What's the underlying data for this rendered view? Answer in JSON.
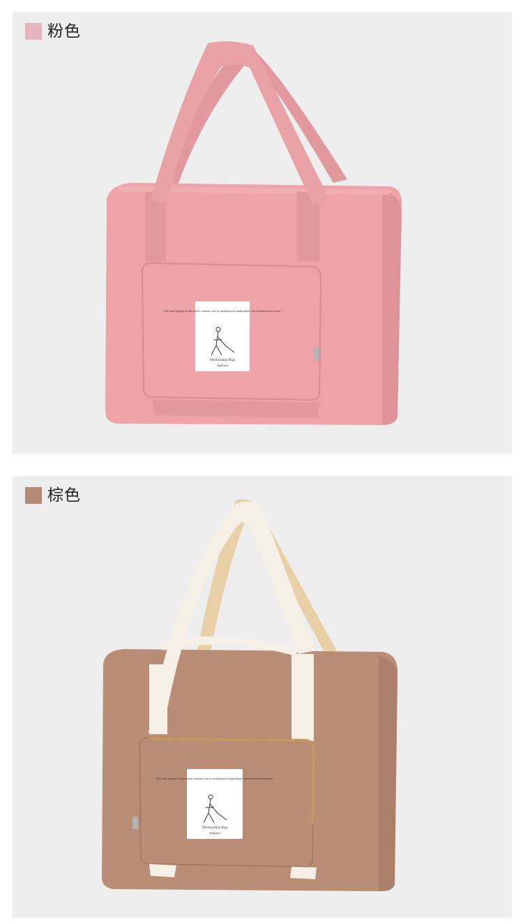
{
  "variants": [
    {
      "label": "粉色",
      "swatch_color": "#e6b5bd",
      "bag_color": "#eda3a8",
      "bag_shade": "#d98b92",
      "strap_color": "#e9a2a6",
      "strap_inner": "#e2999e",
      "tag": {
        "quote": "\"The real voyage of discovery consists, not in seeking new landscapes, but in having new eyes.\"",
        "brand": "Meituozijia Bag",
        "sub": "Fashion"
      }
    },
    {
      "label": "棕色",
      "swatch_color": "#b38a78",
      "bag_color": "#b98d76",
      "bag_shade": "#a77c66",
      "strap_color": "#f5efe6",
      "strap_inner": "#e8cfa6",
      "tag": {
        "quote": "\"The real voyage of discovery consists, not in seeking new landscapes, but in having new eyes.\"",
        "brand": "Meituozijia Bag",
        "sub": "Fashion"
      }
    }
  ]
}
